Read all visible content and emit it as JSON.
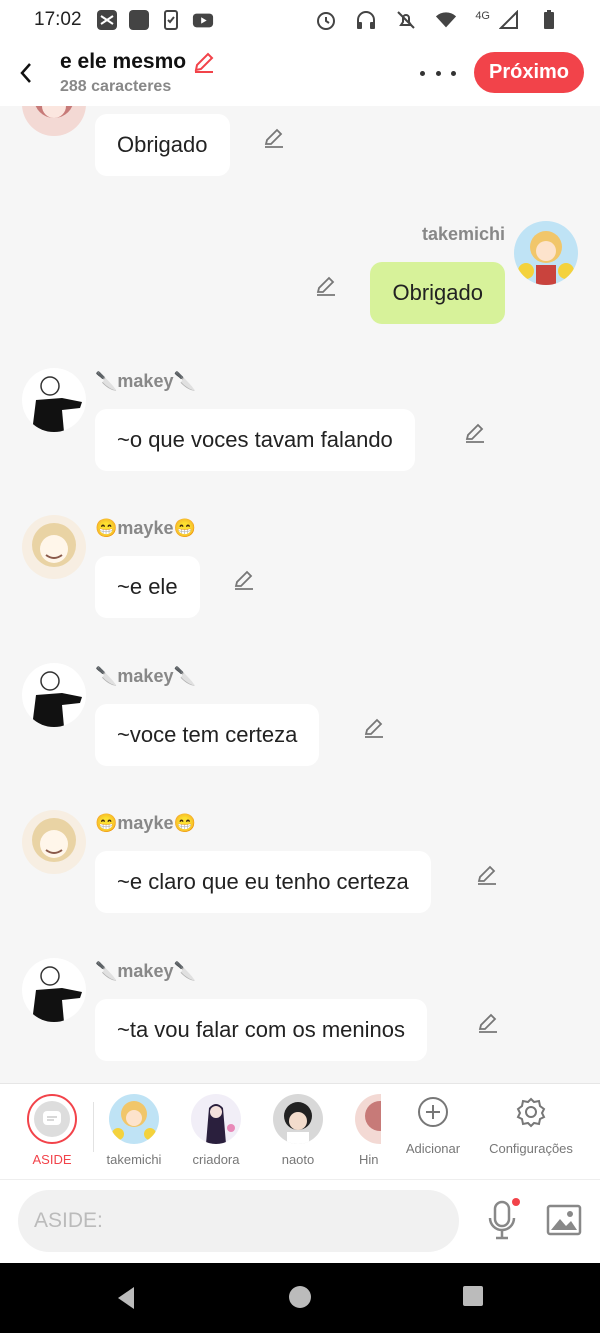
{
  "status": {
    "time": "17:02",
    "network": "4G"
  },
  "header": {
    "title": "e ele mesmo",
    "subtitle": "288 caracteres",
    "next_label": "Próximo"
  },
  "messages": [
    {
      "sender": "",
      "text": "Obrigado",
      "side": "left"
    },
    {
      "sender": "takemichi",
      "text": "Obrigado",
      "side": "right"
    },
    {
      "sender": "🔪makey🔪",
      "text": "~o que voces tavam falando",
      "side": "left"
    },
    {
      "sender": "😁mayke😁",
      "text": "~e ele",
      "side": "left"
    },
    {
      "sender": "🔪makey🔪",
      "text": "~voce tem certeza",
      "side": "left"
    },
    {
      "sender": "😁mayke😁",
      "text": "~e claro que eu tenho certeza",
      "side": "left"
    },
    {
      "sender": "🔪makey🔪",
      "text": "~ta vou falar com os meninos",
      "side": "left"
    }
  ],
  "characters": [
    {
      "label": "ASIDE"
    },
    {
      "label": "takemichi"
    },
    {
      "label": "criadora"
    },
    {
      "label": "naoto"
    },
    {
      "label": "Hin"
    }
  ],
  "tools": {
    "add_label": "Adicionar",
    "settings_label": "Configurações"
  },
  "input": {
    "placeholder": "ASIDE:"
  },
  "colors": {
    "accent": "#f2434a",
    "my_bubble": "#d7f29a",
    "bubble": "#ffffff",
    "background": "#f6f6f6"
  }
}
